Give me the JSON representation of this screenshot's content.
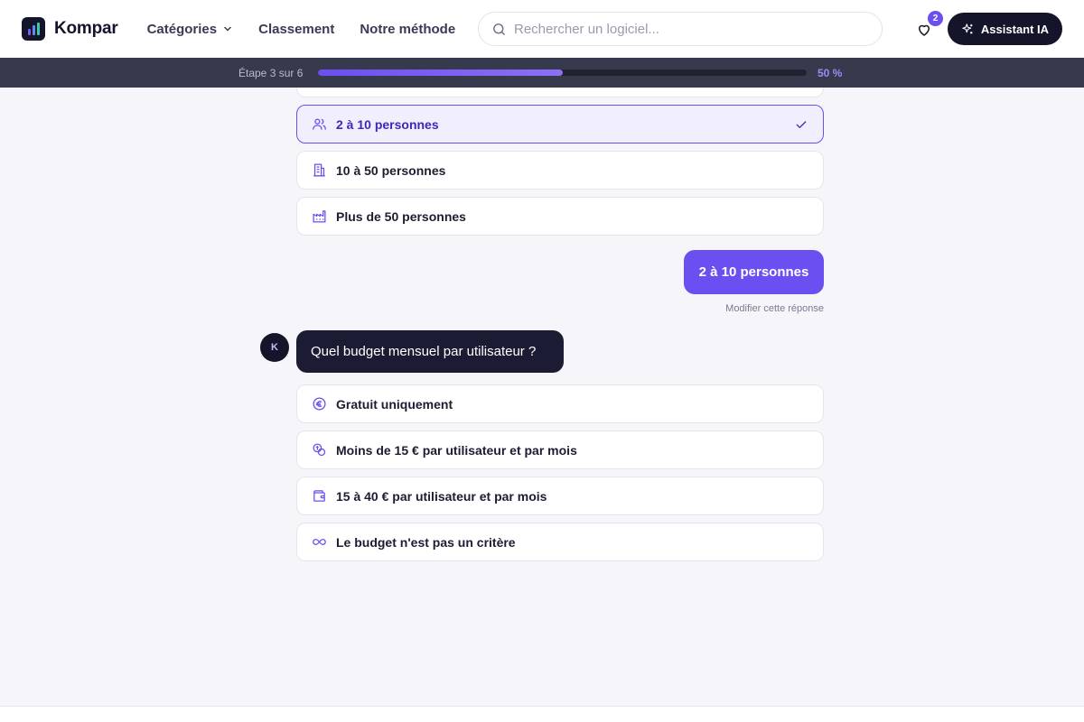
{
  "header": {
    "brand": "Kompar",
    "nav": [
      {
        "label": "Catégories",
        "has_dropdown": true
      },
      {
        "label": "Classement"
      },
      {
        "label": "Notre méthode"
      }
    ],
    "search_placeholder": "Rechercher un logiciel...",
    "favorites_count": "2",
    "assistant_label": "Assistant IA"
  },
  "progress": {
    "step_label": "Étape 3 sur 6",
    "percent_label": "50 %",
    "value": 0.5
  },
  "team_size_options": [
    {
      "label": "2 à 10 personnes",
      "icon": "users-icon",
      "selected": true
    },
    {
      "label": "10 à 50 personnes",
      "icon": "building-icon",
      "selected": false
    },
    {
      "label": "Plus de 50 personnes",
      "icon": "factory-icon",
      "selected": false
    }
  ],
  "user_answer": "2 à 10 personnes",
  "modify_link": "Modifier cette réponse",
  "bot": {
    "avatar_letter": "K",
    "question": "Quel budget mensuel par utilisateur ?"
  },
  "budget_options": [
    {
      "label": "Gratuit uniquement",
      "icon": "euro-icon"
    },
    {
      "label": "Moins de 15 € par utilisateur et par mois",
      "icon": "coins-icon"
    },
    {
      "label": "15 à 40 € par utilisateur et par mois",
      "icon": "wallet-icon"
    },
    {
      "label": "Le budget n'est pas un critère",
      "icon": "infinity-icon"
    }
  ],
  "colors": {
    "accent": "#6b4ff0",
    "dark": "#14142b",
    "background": "#f6f6fa",
    "progress_strip": "#373a4d"
  }
}
